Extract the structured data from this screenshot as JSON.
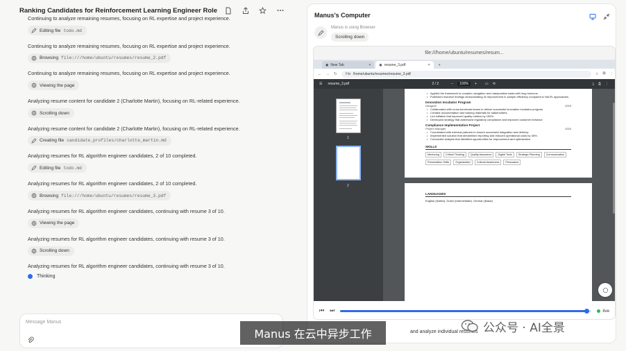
{
  "left": {
    "title": "Ranking Candidates for Reinforcement Learning Engineer Role",
    "steps": [
      {
        "msg": "Continuing to analyze remaining resumes, focusing on RL expertise and project experience.",
        "chip_label": "Editing file",
        "chip_path": "todo.md",
        "icon": "edit-icon"
      },
      {
        "msg": "Continuing to analyze remaining resumes, focusing on RL expertise and project experience.",
        "chip_label": "Browsing",
        "chip_path": "file:///home/ubuntu/resumes/resume_2.pdf",
        "icon": "globe-icon"
      },
      {
        "msg": "Continuing to analyze remaining resumes, focusing on RL expertise and project experience.",
        "chip_label": "Viewing the page",
        "chip_path": "",
        "icon": "globe-icon"
      },
      {
        "msg": "Analyzing resume content for candidate 2 (Charlotte Martin), focusing on RL-related experience.",
        "chip_label": "Scrolling down",
        "chip_path": "",
        "icon": "globe-icon"
      },
      {
        "msg": "Analyzing resume content for candidate 2 (Charlotte Martin), focusing on RL-related experience.",
        "chip_label": "Creating file",
        "chip_path": "candidate_profiles/charlotte_martin.md",
        "icon": "edit-icon"
      },
      {
        "msg": "Analyzing resumes for RL algorithm engineer candidates, 2 of 10 completed.",
        "chip_label": "Editing file",
        "chip_path": "todo.md",
        "icon": "edit-icon"
      },
      {
        "msg": "Analyzing resumes for RL algorithm engineer candidates, 2 of 10 completed.",
        "chip_label": "Browsing",
        "chip_path": "file:///home/ubuntu/resumes/resume_3.pdf",
        "icon": "globe-icon"
      },
      {
        "msg": "Analyzing resumes for RL algorithm engineer candidates, continuing with resume 3 of 10.",
        "chip_label": "Viewing the page",
        "chip_path": "",
        "icon": "globe-icon"
      },
      {
        "msg": "Analyzing resumes for RL algorithm engineer candidates, continuing with resume 3 of 10.",
        "chip_label": "Scrolling down",
        "chip_path": "",
        "icon": "globe-icon"
      }
    ],
    "last_msg": "Analyzing resumes for RL algorithm engineer candidates, continuing with resume 3 of 10.",
    "thinking": "Thinking",
    "input_placeholder": "Message Manus"
  },
  "right": {
    "title": "Manus's Computer",
    "using": "Manus is using Browser",
    "status_chip": "Scrolling down",
    "window_url": "file:///home/ubuntu/resumes/resum...",
    "tabs": [
      "New Tab",
      "resume_3.pdf"
    ],
    "address": "/home/ubuntu/resumes/resume_3.pdf",
    "address_prefix": "File",
    "pdf_name": "resume_3.pdf",
    "page_info": "2 / 2",
    "zoom": "100%",
    "thumb_pages": [
      "1",
      "2"
    ],
    "live": "live",
    "progress": 0.98,
    "task": "and analyze individual resumes"
  },
  "pdf": {
    "top_bullets": [
      "Applied the framework to complex navigation and manipulation tasks with long horizons.",
      "Published research findings demonstrating 4x improvement in sample efficiency compared to flat RL approaches."
    ],
    "sections": [
      {
        "title": "Innovation Incubator Program",
        "role": "Designer",
        "year": "2025",
        "bullets": [
          "Collaborated with cross-functional teams to deliver successful innovation incubator program.",
          "Created documentation and training materials for stakeholders.",
          "Led initiative that improved quality metrics by 100%.",
          "Developed strategy that addressed regulatory compliance and improved customer behavior."
        ]
      },
      {
        "title": "Compliance Implementation Project",
        "role": "Project Manager",
        "year": "2024",
        "bullets": [
          "Coordinated with external partners to ensure successful integration and delivery.",
          "Implemented solution that streamlined reporting and reduced operational costs by 35%.",
          "Conducted analysis that identified opportunities for improvement and optimization."
        ]
      }
    ],
    "skills_title": "SKILLS",
    "skills": [
      "Mentoring",
      "Critical Thinking",
      "Quality Assurance",
      "Digital Tools",
      "Strategic Planning",
      "Communication",
      "Presentation Skills",
      "Organization",
      "Cultural Awareness",
      "Persuasion"
    ],
    "languages_title": "LANGUAGES",
    "languages": "English (Native), Dutch (Intermediate), German (Basic)"
  },
  "overlay": {
    "subtitle": "Manus 在云中异步工作",
    "watermark": "公众号 · AI全景"
  }
}
